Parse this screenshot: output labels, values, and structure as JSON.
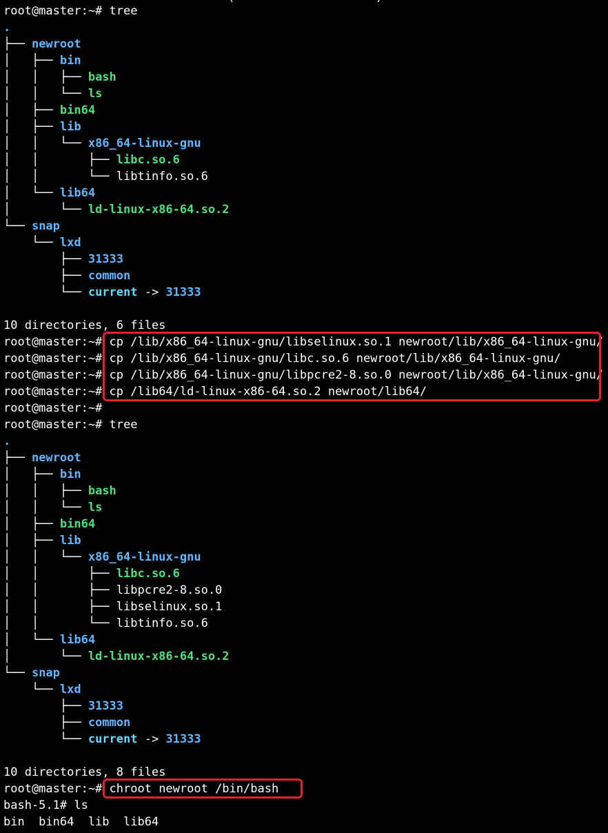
{
  "colors": {
    "background": "#000000",
    "text": "#ffffff",
    "directory": "#5fb8ff",
    "executable": "#4ee07a",
    "symlink": "#5fdcff",
    "highlight": "#e8202a"
  },
  "top_fragment": "(                    )",
  "prompt": "root@master:~#",
  "session1": {
    "cmd": "tree",
    "dot": ".",
    "newroot": "newroot",
    "bin": "bin",
    "bash": "bash",
    "ls": "ls",
    "bin64": "bin64",
    "lib": "lib",
    "x86": "x86_64-linux-gnu",
    "libc": "libc.so.6",
    "libtinfo": "libtinfo.so.6",
    "lib64": "lib64",
    "ld": "ld-linux-x86-64.so.2",
    "snap": "snap",
    "lxd": "lxd",
    "n31333": "31333",
    "common": "common",
    "current": "current",
    "arrow": " -> ",
    "target": "31333",
    "summary": "10 directories, 6 files"
  },
  "copy_commands": [
    "cp /lib/x86_64-linux-gnu/libselinux.so.1 newroot/lib/x86_64-linux-gnu/",
    "cp /lib/x86_64-linux-gnu/libc.so.6 newroot/lib/x86_64-linux-gnu/",
    "cp /lib/x86_64-linux-gnu/libpcre2-8.so.0 newroot/lib/x86_64-linux-gnu/",
    "cp /lib64/ld-linux-x86-64.so.2 newroot/lib64/"
  ],
  "session2": {
    "cmd": "tree",
    "dot": ".",
    "newroot": "newroot",
    "bin": "bin",
    "bash": "bash",
    "ls": "ls",
    "bin64": "bin64",
    "lib": "lib",
    "x86": "x86_64-linux-gnu",
    "libc": "libc.so.6",
    "libpcre": "libpcre2-8.so.0",
    "libselinux": "libselinux.so.1",
    "libtinfo": "libtinfo.so.6",
    "lib64": "lib64",
    "ld": "ld-linux-x86-64.so.2",
    "snap": "snap",
    "lxd": "lxd",
    "n31333": "31333",
    "common": "common",
    "current": "current",
    "arrow": " -> ",
    "target": "31333",
    "summary": "10 directories, 8 files"
  },
  "chroot_cmd": "chroot newroot /bin/bash",
  "bash_prompt": "bash-5.1# ",
  "bash_cmd": "ls",
  "ls_output": "bin  bin64  lib  lib64"
}
